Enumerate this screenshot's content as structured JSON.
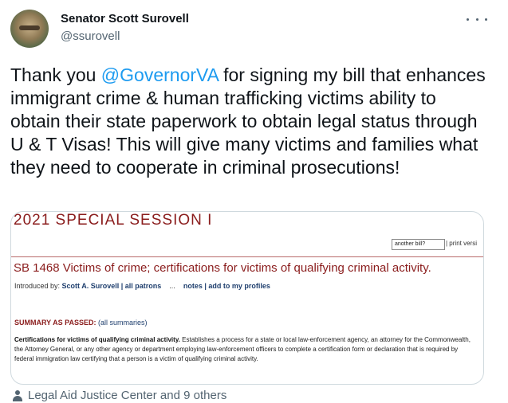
{
  "author": {
    "name": "Senator Scott Surovell",
    "handle": "@ssurovell"
  },
  "tweet": {
    "text_before": "Thank you ",
    "mention": "@GovernorVA",
    "text_after": " for signing my bill that enhances immigrant crime & human trafficking victims ability to obtain their state paperwork to obtain legal status through U & T Visas!  This will give many victims and families what they need to cooperate in criminal prosecutions!"
  },
  "image": {
    "session_title": "2021 SPECIAL SESSION I",
    "bill_input_value": "another bill?",
    "print_link": "| print versi",
    "bill_title": "SB 1468 Victims of crime; certifications for victims of qualifying criminal activity.",
    "introduced_by_label": "Introduced by: ",
    "introducer": "Scott A. Surovell",
    "all_patrons": "| all patrons",
    "ellipsis": "...",
    "notes": "notes",
    "add_to_profiles": "| add to my profiles",
    "summary_label": "SUMMARY AS PASSED: ",
    "all_summaries": "(all summaries)",
    "summary_bold": "Certifications for victims of qualifying criminal activity.",
    "summary_text": " Establishes a process for a state or local law-enforcement agency, an attorney for the Commonwealth, the Attorney General, or any other agency or department employing law-enforcement officers to complete a certification form or declaration that is required by federal immigration law certifying that a person is a victim of qualifying criminal activity."
  },
  "footer": {
    "tagged": "Legal Aid Justice Center and 9 others"
  },
  "icons": {
    "more": "more-dots-icon",
    "person": "person-icon"
  },
  "colors": {
    "link": "#1d9bf0",
    "session_red": "#8a1c1c",
    "muted": "#536471"
  }
}
